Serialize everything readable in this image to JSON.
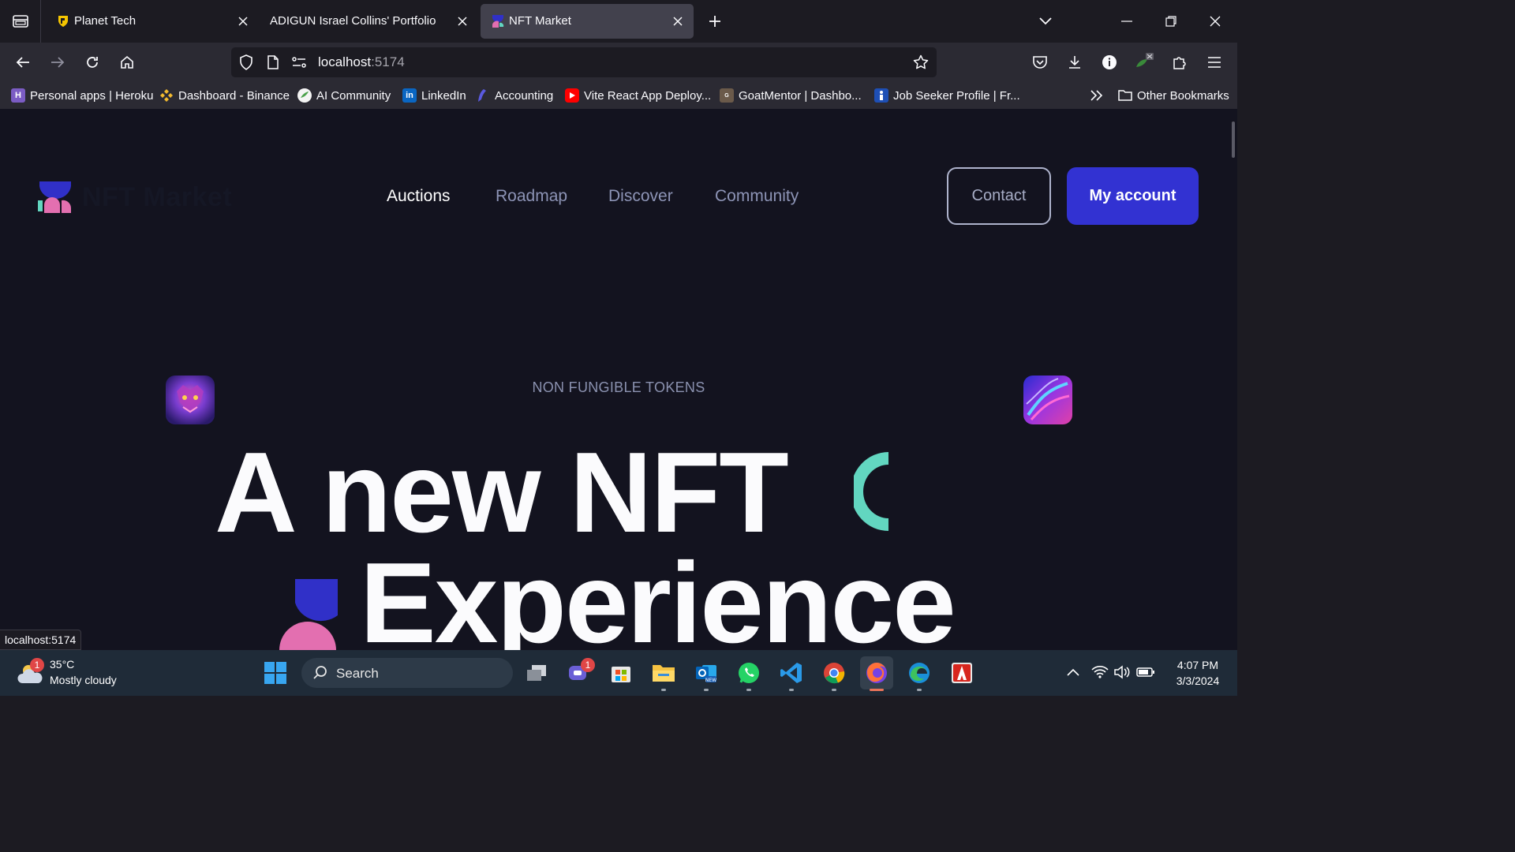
{
  "browser": {
    "tabs": [
      {
        "title": "Planet Tech",
        "active": false
      },
      {
        "title": "ADIGUN Israel Collins' Portfolio",
        "active": false
      },
      {
        "title": "NFT Market",
        "active": true
      }
    ],
    "url": {
      "host": "localhost",
      "port": ":5174"
    },
    "bookmarks": [
      {
        "label": "Personal apps | Heroku",
        "icon": "heroku-icon"
      },
      {
        "label": "Dashboard - Binance",
        "icon": "binance-icon"
      },
      {
        "label": "AI Community",
        "icon": "ai-community-icon"
      },
      {
        "label": "LinkedIn",
        "icon": "linkedin-icon"
      },
      {
        "label": "Accounting",
        "icon": "accounting-icon"
      },
      {
        "label": "Vite React App Deploy...",
        "icon": "youtube-icon"
      },
      {
        "label": "GoatMentor | Dashbo...",
        "icon": "goatmentor-icon"
      },
      {
        "label": "Job Seeker Profile | Fr...",
        "icon": "job-seeker-icon"
      }
    ],
    "other_bookmarks": "Other Bookmarks",
    "status_url": "localhost:5174"
  },
  "site": {
    "logo_text": "NFT Market",
    "nav": [
      "Auctions",
      "Roadmap",
      "Discover",
      "Community"
    ],
    "active_nav": "Auctions",
    "contact_label": "Contact",
    "account_label": "My account",
    "eyebrow": "NON FUNGIBLE TOKENS",
    "headline_line1": "A new NFT",
    "headline_line2": "Experience",
    "colors": {
      "background": "#13131f",
      "accent_blue": "#3232d2",
      "teal": "#62d6c0",
      "pink": "#e36fb0",
      "logo_blue": "#3030c8"
    }
  },
  "taskbar": {
    "weather": {
      "temp": "35°C",
      "desc": "Mostly cloudy",
      "badge": "1"
    },
    "search_label": "Search",
    "apps": [
      "task-view-icon",
      "teams-chat-icon",
      "microsoft-store-icon",
      "file-explorer-icon",
      "outlook-new-icon",
      "whatsapp-icon",
      "vscode-icon",
      "chrome-icon",
      "firefox-icon",
      "edge-icon",
      "acrobat-icon"
    ],
    "chat_badge": "1",
    "time": "4:07 PM",
    "date": "3/3/2024"
  }
}
